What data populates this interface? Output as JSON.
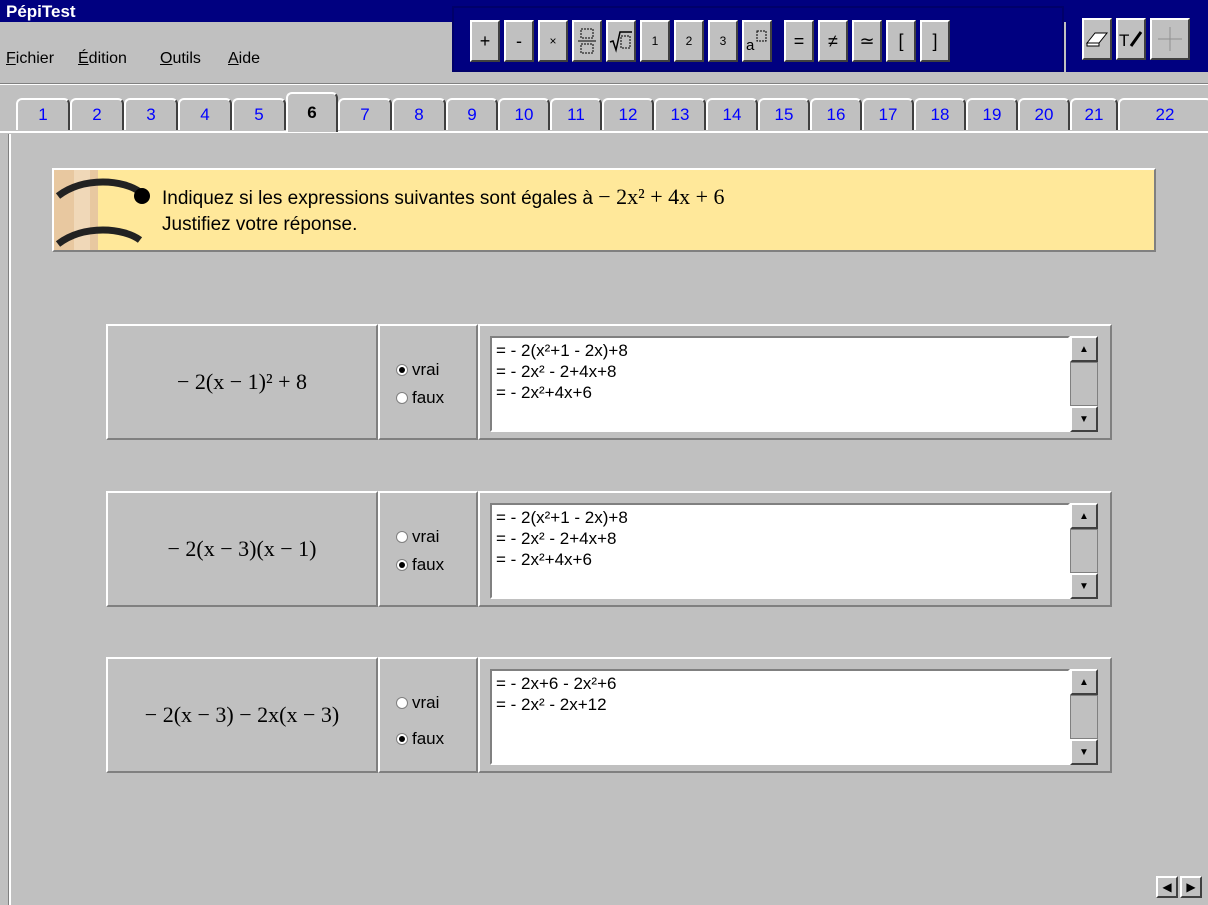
{
  "app": {
    "title": "PépiTest"
  },
  "menu": [
    {
      "label": "Fichier",
      "accel": "F",
      "rest": "ichier"
    },
    {
      "label": "Édition",
      "accel": "É",
      "rest": "dition"
    },
    {
      "label": "Outils",
      "accel": "O",
      "rest": "utils"
    },
    {
      "label": "Aide",
      "accel": "A",
      "rest": "ide"
    }
  ],
  "toolbar": {
    "buttons": [
      "+",
      "-",
      "×",
      "fraction-icon",
      "sqrt-icon",
      "¹",
      "²",
      "³",
      "power-icon",
      "=",
      "≠",
      "≃",
      "[",
      "]"
    ],
    "labels": {
      "plus": "+",
      "minus": "-",
      "times": "×",
      "sup1": "1",
      "sup2": "2",
      "sup3": "3",
      "equal": "=",
      "notequal": "≠",
      "approx": "≃",
      "lbracket": "[",
      "rbracket": "]"
    },
    "tools": [
      "eraser-icon",
      "text-pen-icon",
      "crosshair-icon"
    ]
  },
  "tabs": [
    "1",
    "2",
    "3",
    "4",
    "5",
    "6",
    "7",
    "8",
    "9",
    "10",
    "11",
    "12",
    "13",
    "14",
    "15",
    "16",
    "17",
    "18",
    "19",
    "20",
    "21",
    "22"
  ],
  "active_tab": "6",
  "instruction": {
    "line1": "Indiquez si les expressions suivantes sont égales à",
    "math": "− 2x² + 4x + 6",
    "line2": "Justifiez votre réponse."
  },
  "radio_labels": {
    "true": "vrai",
    "false": "faux"
  },
  "questions": [
    {
      "expression": "− 2(x − 1)² + 8",
      "selected": "vrai",
      "answer_lines": [
        "= - 2(x²+1 - 2x)+8",
        "= - 2x² - 2+4x+8",
        "= - 2x²+4x+6"
      ]
    },
    {
      "expression": "− 2(x − 3)(x − 1)",
      "selected": "faux",
      "answer_lines": [
        "= - 2(x²+1 - 2x)+8",
        "= - 2x² - 2+4x+8",
        "= - 2x²+4x+6"
      ]
    },
    {
      "expression": "− 2(x − 3) − 2x(x − 3)",
      "selected": "faux",
      "answer_lines": [
        "= - 2x+6 - 2x²+6",
        "= - 2x² - 2x+12"
      ]
    }
  ],
  "colors": {
    "title_bar": "#000080",
    "banner": "#ffe89a",
    "tab_text": "#0000ff",
    "window": "#c0c0c0"
  }
}
